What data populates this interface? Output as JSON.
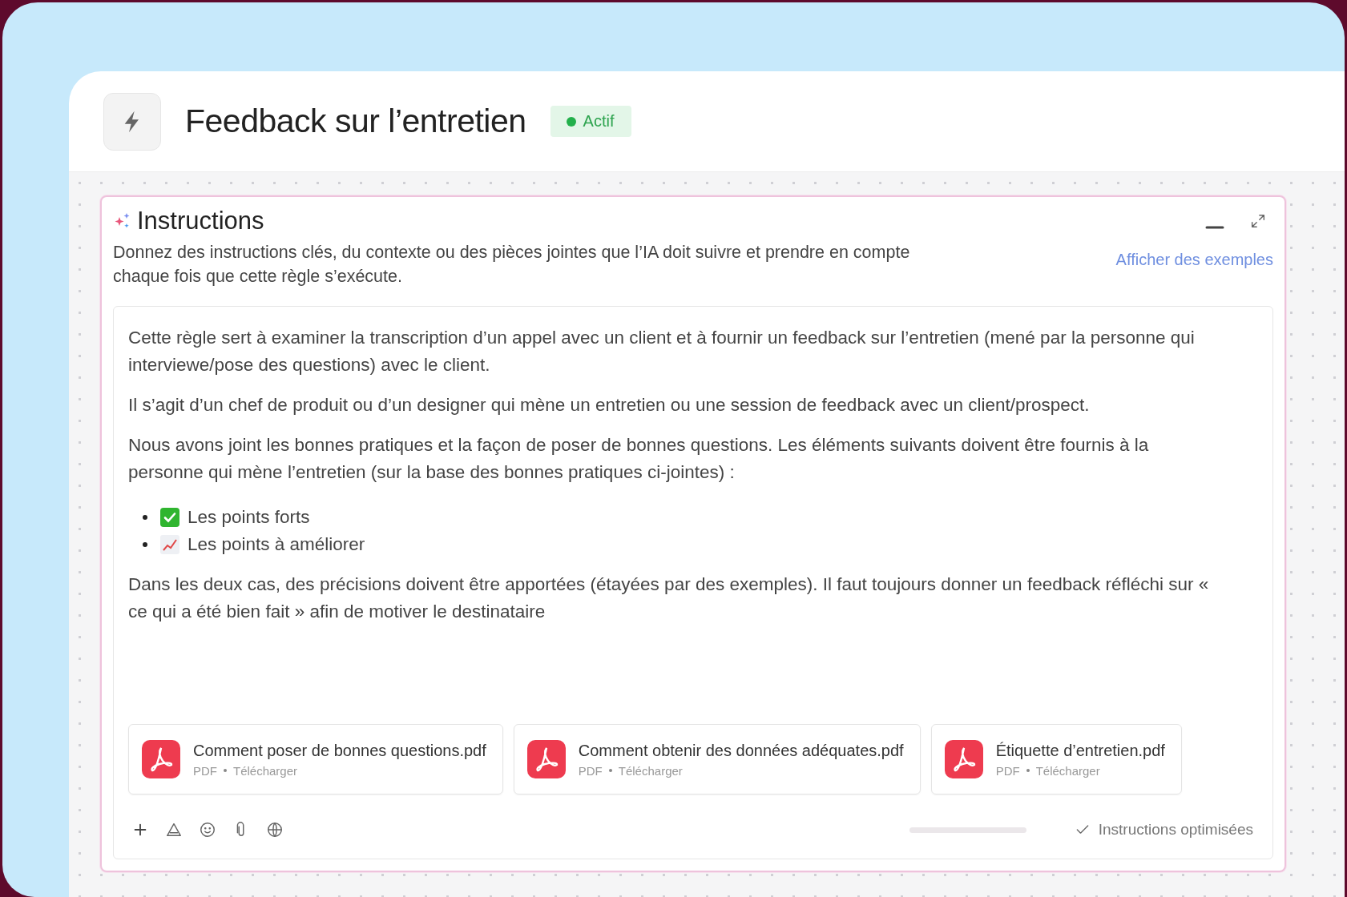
{
  "header": {
    "title": "Feedback sur l’entretien",
    "status": "Actif"
  },
  "panel": {
    "title": "Instructions",
    "description": "Donnez des instructions clés, du contexte ou des pièces jointes que l’IA doit suivre et prendre en compte chaque fois que cette règle s’exécute.",
    "examples_link": "Afficher des exemples",
    "content": [
      {
        "kind": "paragraph",
        "text": "Cette règle sert à examiner la transcription d’un appel avec un client et à fournir un feedback sur l’entretien (mené par la personne qui interviewe/pose des questions) avec le client."
      },
      {
        "kind": "paragraph",
        "text": "Il s’agit d’un chef de produit ou d’un designer qui mène un entretien ou une session de feedback avec un client/prospect."
      },
      {
        "kind": "paragraph",
        "text": "Nous avons joint les bonnes pratiques et la façon de poser de bonnes questions. Les éléments suivants doivent être fournis à la personne qui mène l’entretien (sur la base des bonnes pratiques ci-jointes) :"
      },
      {
        "kind": "list",
        "items": [
          {
            "kind": "check",
            "text": "Les points forts"
          },
          {
            "kind": "chart",
            "text": "Les points à améliorer"
          }
        ]
      },
      {
        "kind": "paragraph",
        "text": "Dans les deux cas, des précisions doivent être apportées (étayées par des exemples). Il faut toujours donner un feedback réfléchi sur « ce qui a été bien fait » afin de motiver le destinataire"
      }
    ],
    "attachments": [
      {
        "name": "Comment poser de bonnes questions.pdf",
        "type": "PDF",
        "action": "Télécharger"
      },
      {
        "name": "Comment obtenir des données adéquates.pdf",
        "type": "PDF",
        "action": "Télécharger"
      },
      {
        "name": "Étiquette d’entretien.pdf",
        "type": "PDF",
        "action": "Télécharger"
      }
    ],
    "status": "Instructions optimisées"
  }
}
